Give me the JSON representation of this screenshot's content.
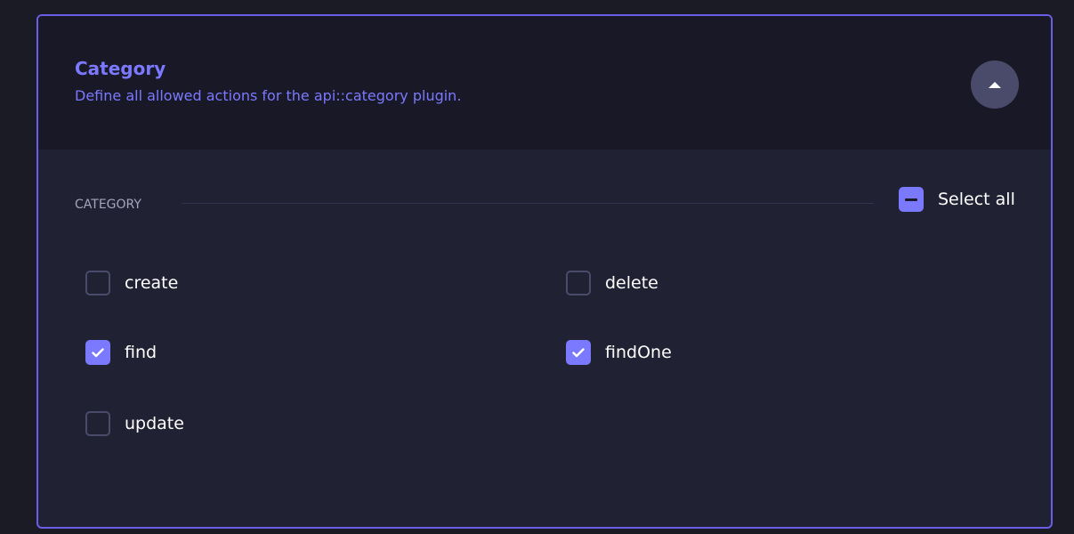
{
  "panel": {
    "title": "Category",
    "subtitle": "Define all allowed actions for the api::category plugin.",
    "expanded": true
  },
  "section": {
    "label": "CATEGORY",
    "select_all_label": "Select all",
    "select_all_state": "indeterminate"
  },
  "actions": [
    {
      "label": "create",
      "checked": false
    },
    {
      "label": "delete",
      "checked": false
    },
    {
      "label": "find",
      "checked": true
    },
    {
      "label": "findOne",
      "checked": true
    },
    {
      "label": "update",
      "checked": false
    }
  ],
  "icons": {
    "toggle": "chevron-up-icon",
    "check": "checkmark-icon",
    "indeterminate": "minus-icon"
  },
  "colors": {
    "accent": "#7b79ff",
    "border": "#6a5ee6",
    "background": "#212134",
    "header_background": "#181826"
  }
}
